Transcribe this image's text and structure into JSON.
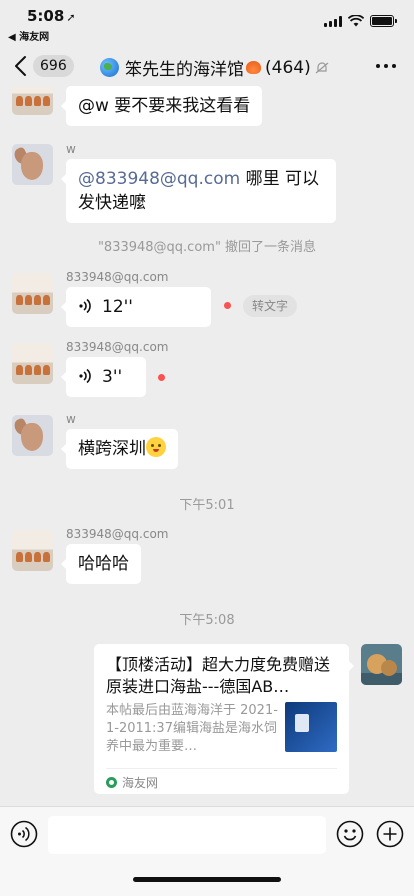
{
  "status_bar": {
    "time": "5:08",
    "back_app": "◀ 海友网"
  },
  "nav": {
    "unread_count": "696",
    "title": "笨先生的海洋馆",
    "member_count": "(464)"
  },
  "messages": [
    {
      "type": "text",
      "sender": "",
      "text": "@w 要不要来我这看看"
    },
    {
      "type": "text",
      "sender": "w",
      "mention": "@833948@qq.com",
      "text": " 哪里 可以发快递嚒"
    },
    {
      "type": "system",
      "text": "\"833948@qq.com\" 撤回了一条消息"
    },
    {
      "type": "voice",
      "sender": "833948@qq.com",
      "duration": "12''",
      "unread": true,
      "transcribe_label": "转文字"
    },
    {
      "type": "voice",
      "sender": "833948@qq.com",
      "duration": "3''",
      "unread": true
    },
    {
      "type": "text",
      "sender": "w",
      "text": "横跨深圳"
    },
    {
      "type": "time",
      "text": "下午5:01"
    },
    {
      "type": "text",
      "sender": "833948@qq.com",
      "text": "哈哈哈"
    },
    {
      "type": "time",
      "text": "下午5:08"
    },
    {
      "type": "link",
      "title": "【顶楼活动】超大力度免费赠送原装进口海盐---德国AB…",
      "desc": "本帖最后由蓝海海洋于 2021-1-2011:37编辑海盐是海水饲养中最为重要…",
      "source": "海友网"
    }
  ],
  "input": {
    "placeholder": ""
  },
  "icons": [
    "back-chevron-icon",
    "globe-icon",
    "shell-icon",
    "mute-bell-icon",
    "more-dots-icon",
    "voice-icon",
    "emoji-icon",
    "plus-icon"
  ]
}
